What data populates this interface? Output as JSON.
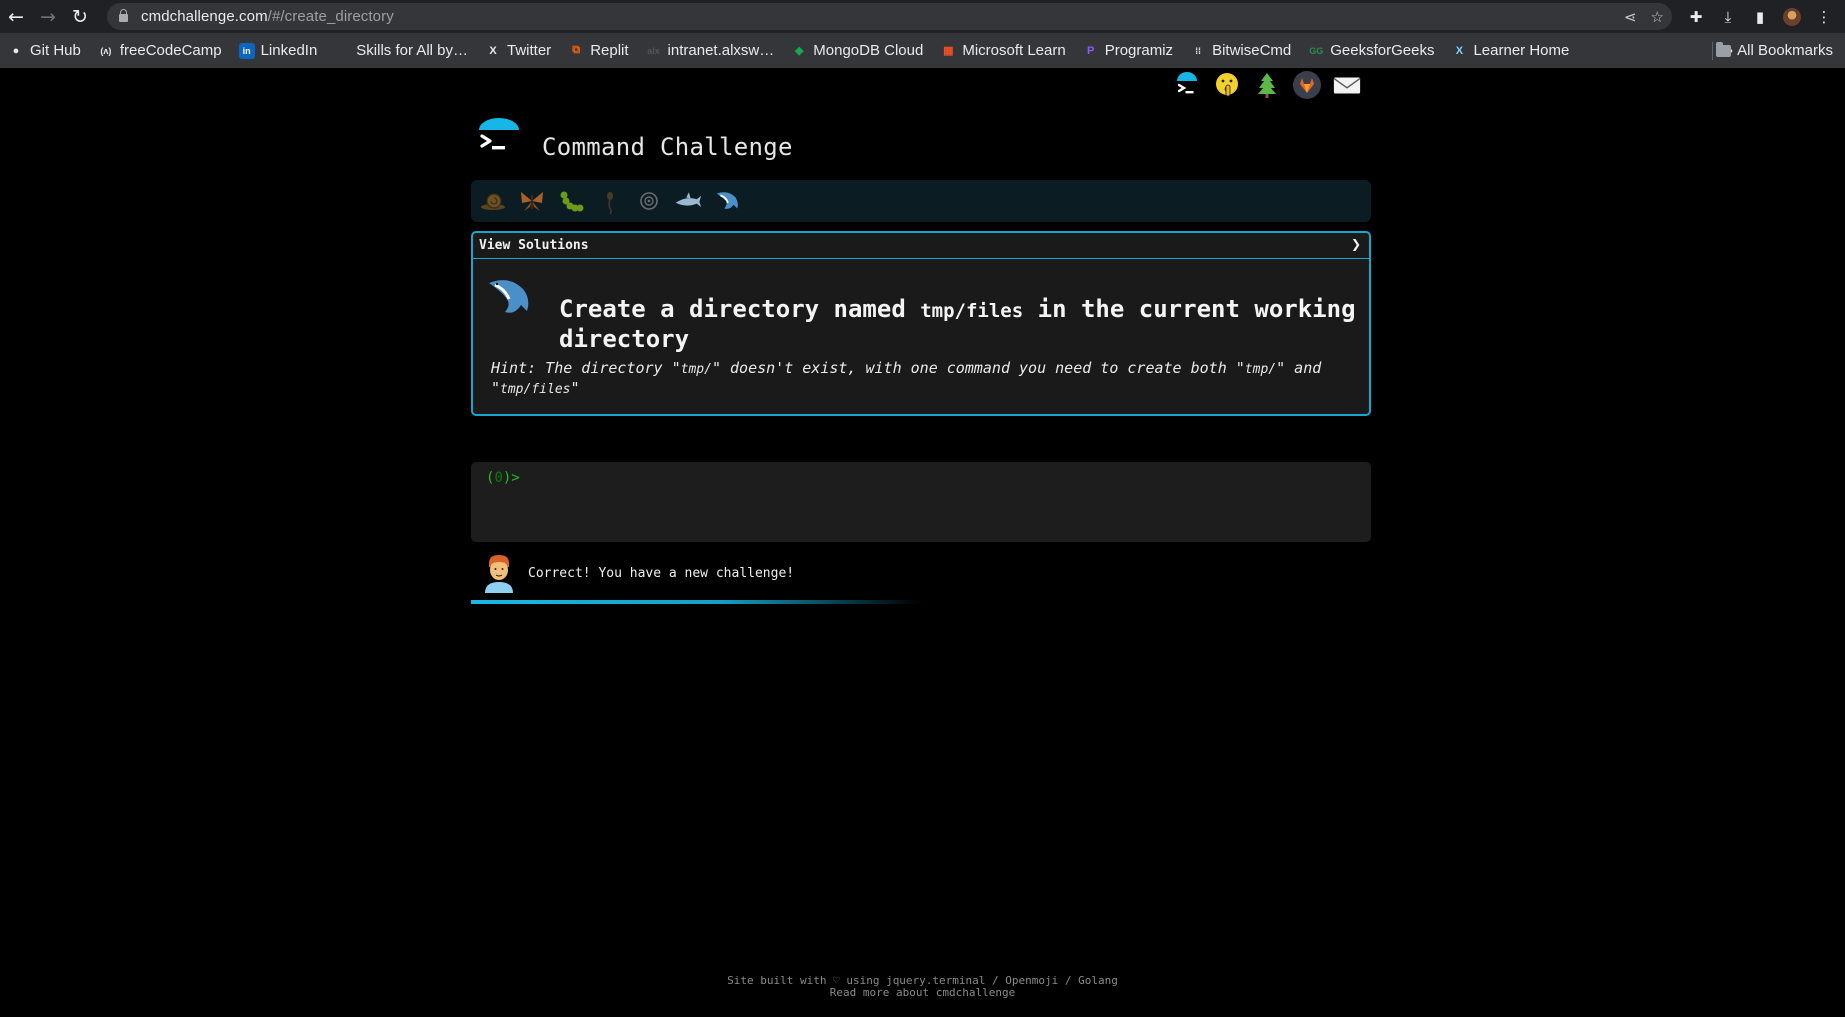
{
  "browser": {
    "url_host": "cmdchallenge.com",
    "url_path": "/#/create_directory"
  },
  "bookmarks": [
    {
      "label": "Git Hub",
      "icon": "github-icon"
    },
    {
      "label": "freeCodeCamp",
      "icon": "freecodecamp-icon"
    },
    {
      "label": "LinkedIn",
      "icon": "linkedin-icon"
    },
    {
      "label": "Skills for All by…",
      "icon": "skills-icon"
    },
    {
      "label": "Twitter",
      "icon": "x-icon"
    },
    {
      "label": "Replit",
      "icon": "replit-icon"
    },
    {
      "label": "intranet.alxsw…",
      "icon": "alx-icon"
    },
    {
      "label": "MongoDB Cloud",
      "icon": "mongodb-icon"
    },
    {
      "label": "Microsoft Learn",
      "icon": "microsoft-icon"
    },
    {
      "label": "Programiz",
      "icon": "programiz-icon"
    },
    {
      "label": "BitwiseCmd",
      "icon": "bitwise-icon"
    },
    {
      "label": "GeeksforGeeks",
      "icon": "gfg-icon"
    },
    {
      "label": "Learner Home",
      "icon": "edx-icon"
    }
  ],
  "bookmarks_more": "»",
  "all_bookmarks": "All Bookmarks",
  "page": {
    "title": "Command Challenge",
    "view_solutions": "View Solutions",
    "expand_arrow": "❯",
    "challenge": {
      "title_pre": "Create a directory named ",
      "title_code": "tmp/files",
      "title_post": " in the current working directory",
      "hint_1": "Hint: The directory \"",
      "hint_code_1": "tmp/",
      "hint_2": "\" doesn't exist, with one command you need to create both \"",
      "hint_code_2": "tmp/",
      "hint_3": "\" and \"",
      "hint_code_3": "tmp/files",
      "hint_4": "\""
    },
    "prompt_open": "(",
    "prompt_num": "0",
    "prompt_close": ")>",
    "message": "Correct! You have a new challenge!",
    "progress_fraction": 0.5,
    "footer_line1": "Site built with ♡ using jquery.terminal / Openmoji / Golang",
    "footer_line2": "Read more about cmdchallenge"
  },
  "colors": {
    "accent": "#17a6cd",
    "prompt_green": "#20c020",
    "level_bar_bg": "#0b1c22"
  }
}
